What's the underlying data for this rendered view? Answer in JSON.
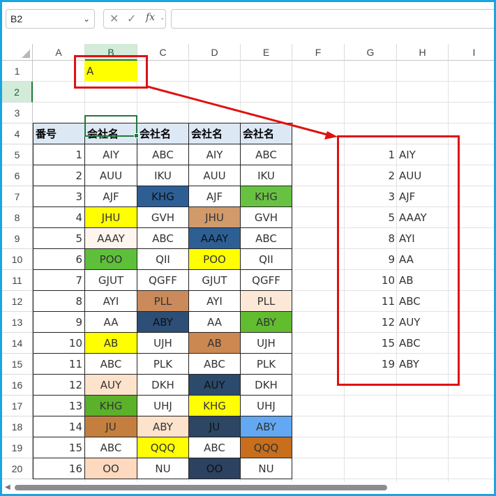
{
  "formula_bar": {
    "name_box": "B2",
    "cancel_icon": "cancel-x-icon",
    "enter_icon": "enter-check-icon",
    "fx_label": "fx",
    "formula": ""
  },
  "columns": [
    "A",
    "B",
    "C",
    "D",
    "E",
    "F",
    "G",
    "H",
    "I"
  ],
  "selected_column": "B",
  "rows": [
    "1",
    "2",
    "3",
    "4",
    "5",
    "6",
    "7",
    "8",
    "9",
    "10",
    "11",
    "12",
    "13",
    "14",
    "15",
    "16",
    "17",
    "18",
    "19",
    "20"
  ],
  "selected_row": "2",
  "cell_B1": "A",
  "table": {
    "headers": [
      "番号",
      "会社名",
      "会社名",
      "会社名",
      "会社名"
    ],
    "rows": [
      {
        "n": "1",
        "c": [
          "AIY",
          "ABC",
          "AIY",
          "ABC"
        ],
        "f": [
          "",
          "",
          "",
          ""
        ]
      },
      {
        "n": "2",
        "c": [
          "AUU",
          "IKU",
          "AUU",
          "IKU"
        ],
        "f": [
          "",
          "",
          "",
          ""
        ]
      },
      {
        "n": "3",
        "c": [
          "AJF",
          "KHG",
          "AJF",
          "KHG"
        ],
        "f": [
          "",
          "#2d5f95",
          "",
          "#68c242"
        ]
      },
      {
        "n": "4",
        "c": [
          "JHU",
          "GVH",
          "JHU",
          "GVH"
        ],
        "f": [
          "#ffff00",
          "",
          "#d19a6a",
          ""
        ]
      },
      {
        "n": "5",
        "c": [
          "AAAY",
          "ABC",
          "AAAY",
          "ABC"
        ],
        "f": [
          "#fdf5ee",
          "",
          "#2d5f95",
          ""
        ]
      },
      {
        "n": "6",
        "c": [
          "POO",
          "QII",
          "POO",
          "QII"
        ],
        "f": [
          "#5ec03a",
          "",
          "#ffff00",
          ""
        ]
      },
      {
        "n": "7",
        "c": [
          "GJUT",
          "QGFF",
          "GJUT",
          "QGFF"
        ],
        "f": [
          "",
          "",
          "",
          ""
        ]
      },
      {
        "n": "8",
        "c": [
          "AYI",
          "PLL",
          "AYI",
          "PLL"
        ],
        "f": [
          "",
          "#cb8a5b",
          "",
          "#fde8d8"
        ]
      },
      {
        "n": "9",
        "c": [
          "AA",
          "ABY",
          "AA",
          "ABY"
        ],
        "f": [
          "",
          "#2d4e76",
          "",
          "#61bd2f"
        ]
      },
      {
        "n": "10",
        "c": [
          "AB",
          "UJH",
          "AB",
          "UJH"
        ],
        "f": [
          "#ffff00",
          "",
          "#cc8851",
          ""
        ]
      },
      {
        "n": "11",
        "c": [
          "ABC",
          "PLK",
          "ABC",
          "PLK"
        ],
        "f": [
          "",
          "",
          "",
          ""
        ]
      },
      {
        "n": "12",
        "c": [
          "AUY",
          "DKH",
          "AUY",
          "DKH"
        ],
        "f": [
          "#fde3cc",
          "",
          "#2c4a6b",
          ""
        ]
      },
      {
        "n": "13",
        "c": [
          "KHG",
          "UHJ",
          "KHG",
          "UHJ"
        ],
        "f": [
          "#5bb12a",
          "",
          "#ffff00",
          ""
        ]
      },
      {
        "n": "14",
        "c": [
          "JU",
          "ABY",
          "JU",
          "ABY"
        ],
        "f": [
          "#c47f3e",
          "#fde2cc",
          "#2c4664",
          "#63a8f3"
        ]
      },
      {
        "n": "15",
        "c": [
          "ABC",
          "QQQ",
          "ABC",
          "QQQ"
        ],
        "f": [
          "",
          "#ffff00",
          "",
          "#c86e1d"
        ]
      },
      {
        "n": "16",
        "c": [
          "OO",
          "NU",
          "OO",
          "NU"
        ],
        "f": [
          "#fcd9bf",
          "",
          "#2c4260",
          ""
        ]
      }
    ]
  },
  "result": [
    {
      "n": "1",
      "v": "AIY"
    },
    {
      "n": "2",
      "v": "AUU"
    },
    {
      "n": "3",
      "v": "AJF"
    },
    {
      "n": "5",
      "v": "AAAY"
    },
    {
      "n": "8",
      "v": "AYI"
    },
    {
      "n": "9",
      "v": "AA"
    },
    {
      "n": "10",
      "v": "AB"
    },
    {
      "n": "11",
      "v": "ABC"
    },
    {
      "n": "12",
      "v": "AUY"
    },
    {
      "n": "15",
      "v": "ABC"
    },
    {
      "n": "19",
      "v": "ABY"
    }
  ],
  "colors": {
    "selection_green": "#1f7a3b",
    "annotation_red": "#e01010",
    "header_fill": "#dde8f5",
    "b1_fill": "#ffff00",
    "frame_border": "#19a5e0"
  }
}
